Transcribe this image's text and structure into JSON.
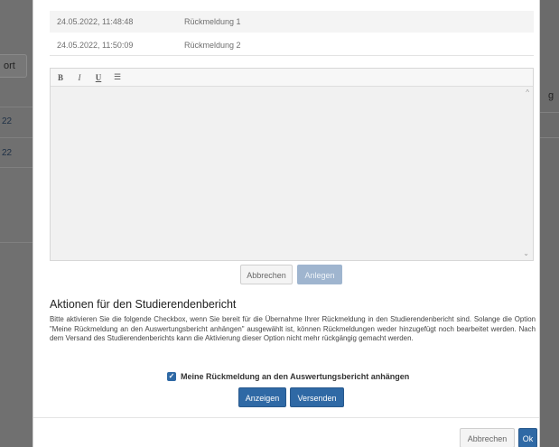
{
  "background": {
    "left_button_label": "ort",
    "left_numbers": [
      "22",
      "22"
    ],
    "right_char": "g"
  },
  "messages": [
    {
      "date": "24.05.2022, 11:48:48",
      "title": "Rückmeldung 1"
    },
    {
      "date": "24.05.2022, 11:50:09",
      "title": "Rückmeldung 2"
    }
  ],
  "editor": {
    "toolbar": {
      "bold": "B",
      "italic": "I",
      "underline": "U",
      "list": "☰"
    },
    "value": "",
    "cancel_label": "Abbrechen",
    "add_label": "Anlegen"
  },
  "actions": {
    "title": "Aktionen für den Studierendenbericht",
    "text": "Bitte aktivieren Sie die folgende Checkbox, wenn Sie bereit für die Übernahme Ihrer Rückmeldung in den Studierendenbericht sind. Solange die Option \"Meine Rückmeldung an den Auswertungsbericht anhängen\" ausgewählt ist, können Rückmeldungen weder hinzugefügt noch bearbeitet werden. Nach dem Versand des Studierendenberichts kann die Aktivierung dieser Option nicht mehr rückgängig gemacht werden.",
    "checkbox_label": "Meine Rückmeldung an den Auswertungsbericht anhängen",
    "checkbox_checked": true,
    "show_label": "Anzeigen",
    "send_label": "Versenden"
  },
  "footer": {
    "cancel_label": "Abbrechen",
    "ok_label": "Ok"
  },
  "colors": {
    "primary": "#2f69a5",
    "disabled": "#9fb5cf"
  }
}
